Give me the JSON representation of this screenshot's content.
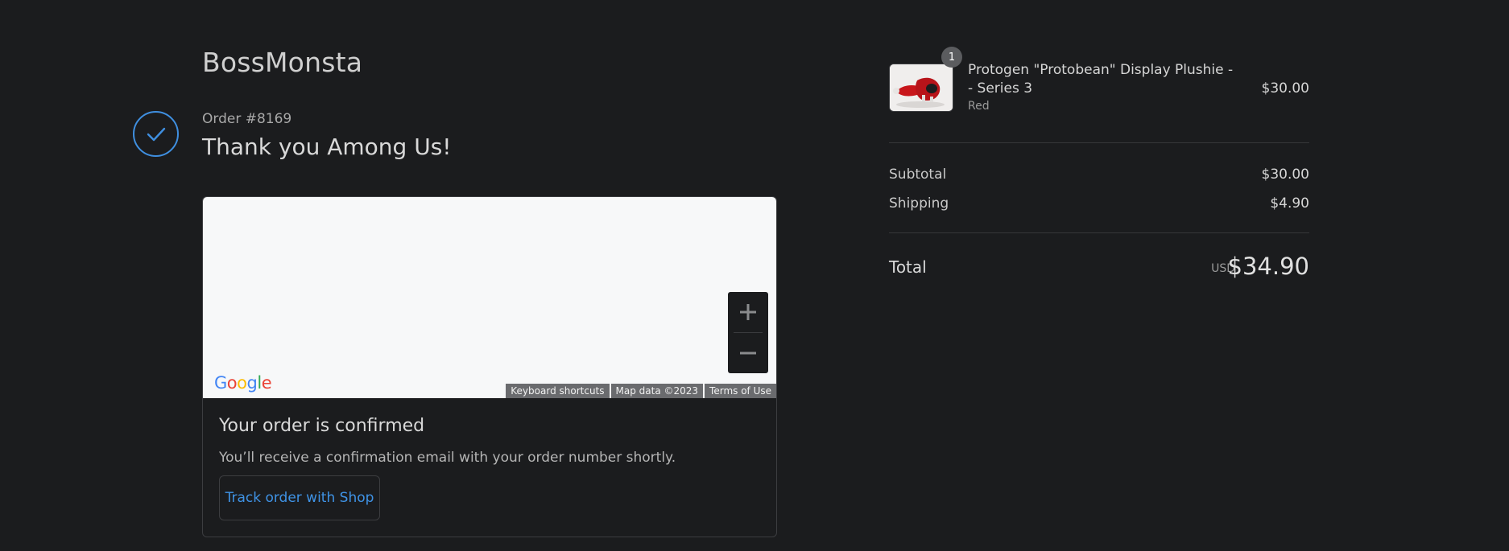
{
  "store": {
    "name": "BossMonsta"
  },
  "order": {
    "number_label": "Order #8169",
    "thank_you": "Thank you Among Us!"
  },
  "map": {
    "logo_text": "Google",
    "footer": {
      "keyboard_shortcuts": "Keyboard shortcuts",
      "map_data": "Map data ©2023",
      "terms": "Terms of Use"
    }
  },
  "confirmation": {
    "title": "Your order is confirmed",
    "message": "You’ll receive a confirmation email with your order number shortly.",
    "track_button": "Track order with Shop"
  },
  "summary": {
    "items": [
      {
        "quantity": "1",
        "name": "Protogen \"Protobean\" Display Plushie -- Series 3",
        "variant": "Red",
        "price": "$30.00"
      }
    ],
    "subtotal_label": "Subtotal",
    "subtotal_value": "$30.00",
    "shipping_label": "Shipping",
    "shipping_value": "$4.90",
    "total_label": "Total",
    "total_currency": "USD",
    "total_value": "$34.90"
  },
  "colors": {
    "background": "#1b1c1e",
    "accent": "#3f8fe0",
    "link": "#3f93e6"
  },
  "icons": {
    "confirmation": "check-circle-icon",
    "zoom_in": "plus-icon",
    "zoom_out": "minus-icon"
  }
}
